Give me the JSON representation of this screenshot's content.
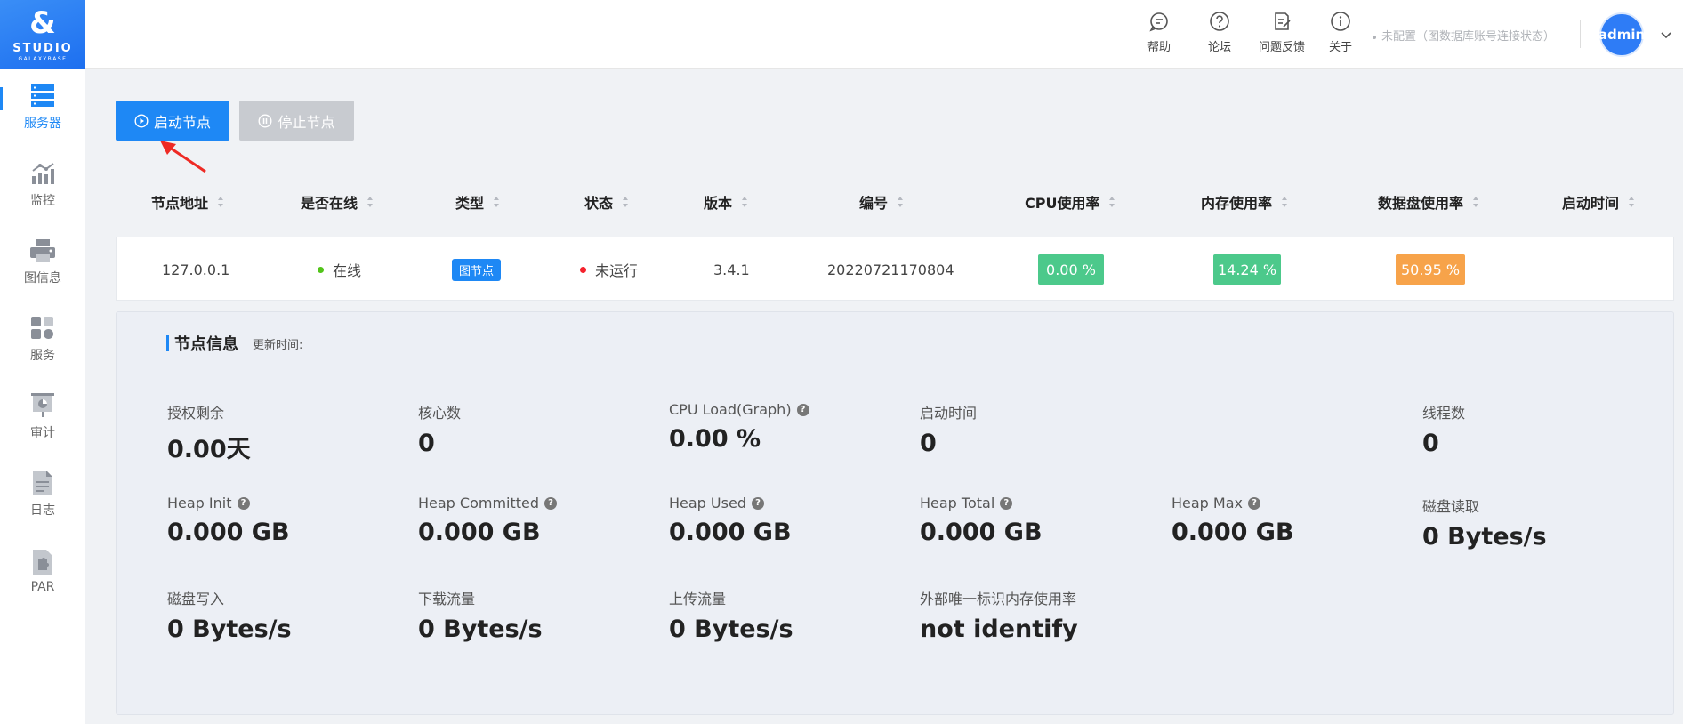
{
  "app": {
    "logo_mark": "&",
    "logo_name": "STUDIO",
    "logo_sub": "GALAXYBASE"
  },
  "sidebar": {
    "items": [
      {
        "label": "服务器",
        "icon": "server-icon",
        "active": true
      },
      {
        "label": "监控",
        "icon": "monitor-chart-icon"
      },
      {
        "label": "图信息",
        "icon": "printer-icon"
      },
      {
        "label": "服务",
        "icon": "services-grid-icon"
      },
      {
        "label": "审计",
        "icon": "audit-board-icon"
      },
      {
        "label": "日志",
        "icon": "log-document-icon"
      },
      {
        "label": "PAR",
        "icon": "puzzle-icon"
      }
    ]
  },
  "header": {
    "help": "帮助",
    "forum": "论坛",
    "feedback": "问题反馈",
    "about": "关于",
    "connection_status": "未配置（图数据库账号连接状态）",
    "user": "admin"
  },
  "toolbar": {
    "start_label": "启动节点",
    "stop_label": "停止节点"
  },
  "table": {
    "columns": [
      "节点地址",
      "是否在线",
      "类型",
      "状态",
      "版本",
      "编号",
      "CPU使用率",
      "内存使用率",
      "数据盘使用率",
      "启动时间"
    ],
    "rows": [
      {
        "address": "127.0.0.1",
        "online": "在线",
        "type": "图节点",
        "status": "未运行",
        "version": "3.4.1",
        "id": "20220721170804",
        "cpu": "0.00 %",
        "memory": "14.24 %",
        "disk": "50.95 %",
        "start_time": ""
      }
    ]
  },
  "node_info": {
    "title": "节点信息",
    "updated_label": "更新时间:",
    "metrics": [
      {
        "label": "授权剩余",
        "value": "0.00天"
      },
      {
        "label": "核心数",
        "value": "0"
      },
      {
        "label": "CPU Load(Graph)",
        "value": "0.00 %",
        "help": true
      },
      {
        "label": "启动时间",
        "value": "0"
      },
      {
        "label": "线程数",
        "value": "0"
      },
      {
        "label": "Heap Init",
        "value": "0.000 GB",
        "help": true
      },
      {
        "label": "Heap Committed",
        "value": "0.000 GB",
        "help": true
      },
      {
        "label": "Heap Used",
        "value": "0.000 GB",
        "help": true
      },
      {
        "label": "Heap Total",
        "value": "0.000 GB",
        "help": true
      },
      {
        "label": "Heap Max",
        "value": "0.000 GB",
        "help": true
      },
      {
        "label": "磁盘读取",
        "value": "0 Bytes/s"
      },
      {
        "label": "磁盘写入",
        "value": "0 Bytes/s"
      },
      {
        "label": "下载流量",
        "value": "0 Bytes/s"
      },
      {
        "label": "上传流量",
        "value": "0 Bytes/s"
      },
      {
        "label": "外部唯一标识内存使用率",
        "value": "not identify"
      }
    ]
  },
  "colors": {
    "primary": "#1e88f5",
    "online": "#52c41a",
    "stopped": "#f5222d",
    "cpu_badge": "#4cc98b",
    "memory_badge": "#4cc98b",
    "disk_badge": "#f7a34a",
    "disabled": "#c8cbd0"
  }
}
